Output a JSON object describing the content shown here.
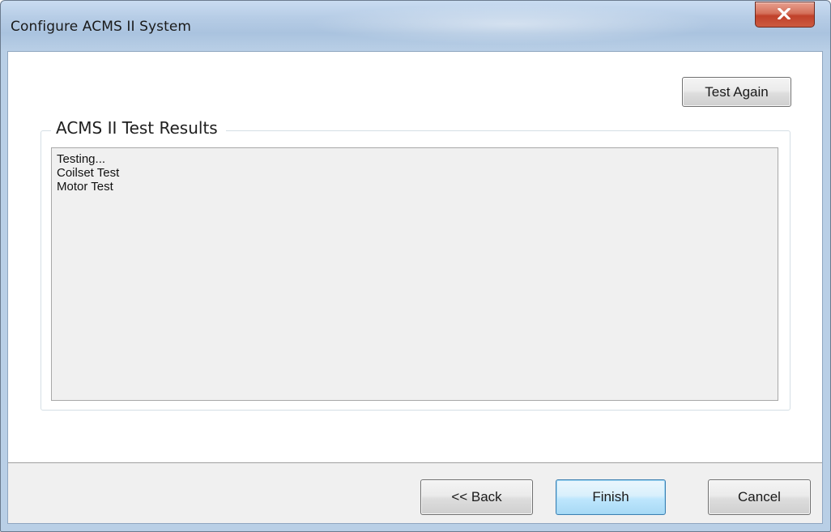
{
  "window": {
    "title": "Configure ACMS II System",
    "close_icon": "close-icon"
  },
  "toolbar": {
    "test_again_label": "Test Again"
  },
  "results": {
    "group_title": "ACMS II Test Results",
    "lines": [
      "Testing...",
      "Coilset Test",
      "Motor Test"
    ]
  },
  "footer": {
    "back_label": "<< Back",
    "finish_label": "Finish",
    "cancel_label": "Cancel"
  },
  "colors": {
    "title_bar": "#b7cde6",
    "close_button": "#c0412a",
    "default_button_highlight": "#3c7fb1"
  }
}
